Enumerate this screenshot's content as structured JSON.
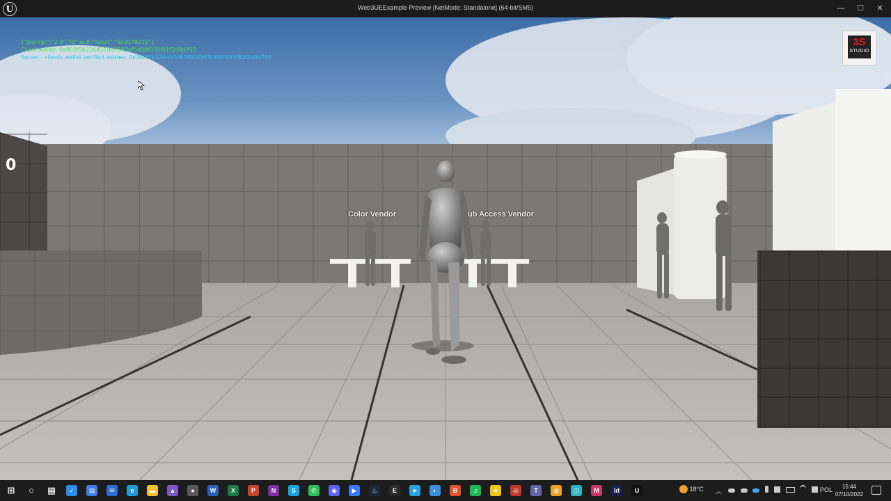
{
  "window": {
    "title": "Web3UEExample Preview [NetMode: Standalone]  (64-bit/SM5)",
    "logo": "U",
    "minimize_glyph": "—",
    "maximize_glyph": "☐",
    "close_glyph": "✕"
  },
  "debug": {
    "line1": "{\"jsonrpc\":\"2.0\",\"id\":null,\"result\":\"0x2078225\"}",
    "line2": "Client wallet: 0x002f5b226457d87882ef5d08f035f81f2d0d750",
    "line3": "Server - clients wallet verified addres: 0x002f5b226457d87882EbF5d08F035f81f2d0d750"
  },
  "hud": {
    "score": "0",
    "badge_top": "3S",
    "badge_bottom": "STUDIO"
  },
  "vendors": {
    "color_vendor": "Color Vendor",
    "club_access_vendor": "ub Access Vendor"
  },
  "colors": {
    "sky_top": "#3e6ea8",
    "wall": "#7a7876",
    "floor": "#b9b6b3",
    "debug_green": "#4ee04e",
    "debug_cyan": "#2ac8ee",
    "taskbar": "#1c1c1c"
  },
  "taskbar": {
    "icons": [
      "windows-start-icon",
      "search-icon",
      "task-view-icon",
      "visual-studio-code-icon",
      "calendar-icon",
      "mail-icon",
      "edge-icon",
      "file-explorer-icon",
      "visual-studio-icon",
      "obs-icon",
      "word-icon",
      "excel-icon",
      "powerpoint-icon",
      "onenote-icon",
      "skype-icon",
      "whatsapp-icon",
      "discord-icon",
      "app-icon",
      "steam-icon",
      "epic-games-icon",
      "telegram-icon",
      "app-icon-2",
      "brave-icon",
      "spotify-icon",
      "star-app-icon",
      "recorder-icon",
      "teams-icon",
      "chrome-icon",
      "app-icon-3",
      "app-icon-4",
      "indesign-icon",
      "unreal-engine-icon"
    ],
    "weather": "18°C",
    "language": "POL",
    "time": "15:44",
    "date": "07/10/2022"
  }
}
